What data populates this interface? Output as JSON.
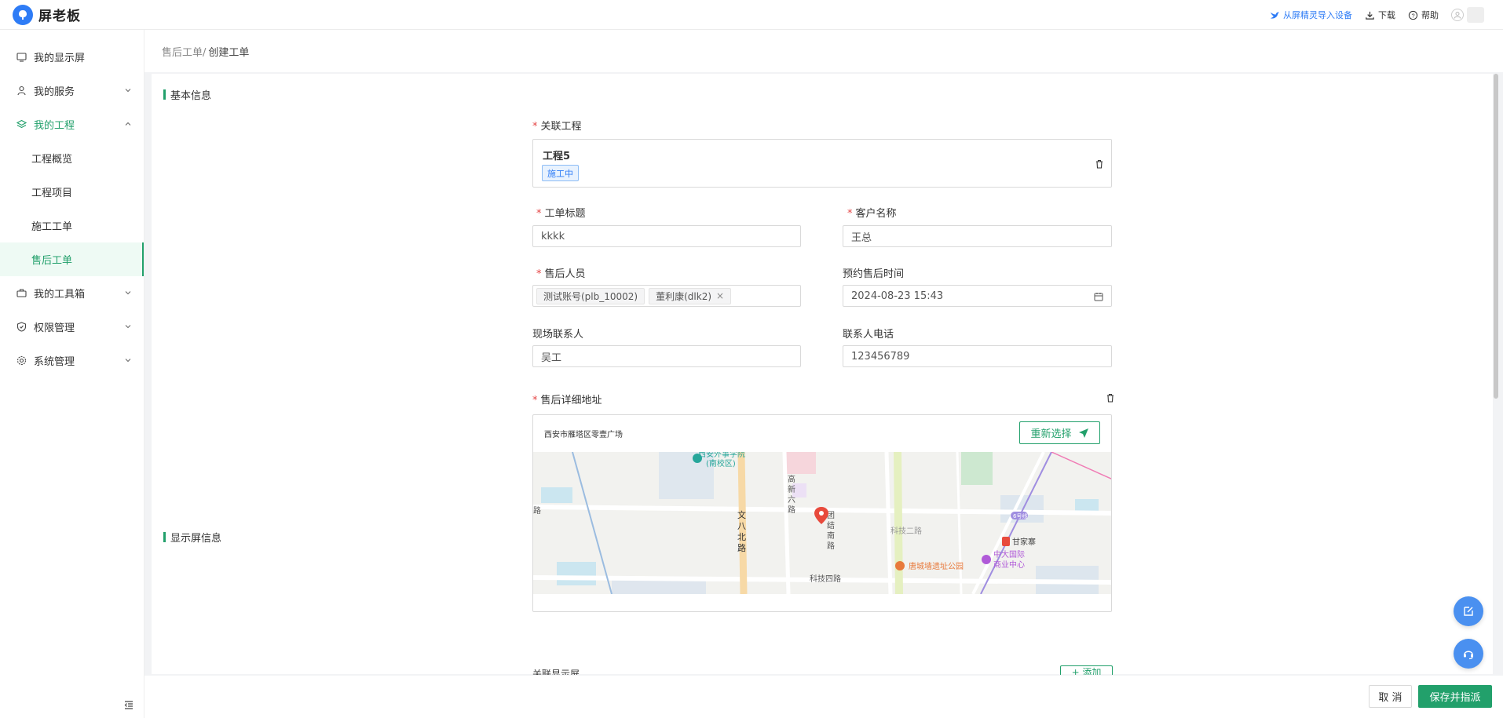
{
  "app": {
    "name": "屏老板"
  },
  "header": {
    "import_label": "从屏精灵导入设备",
    "download_label": "下载",
    "help_label": "帮助"
  },
  "sidebar": {
    "items": [
      {
        "label": "我的显示屏"
      },
      {
        "label": "我的服务"
      },
      {
        "label": "我的工程"
      },
      {
        "label": "我的工具箱"
      },
      {
        "label": "权限管理"
      },
      {
        "label": "系统管理"
      }
    ],
    "sub_items": [
      {
        "label": "工程概览"
      },
      {
        "label": "工程项目"
      },
      {
        "label": "施工工单"
      },
      {
        "label": "售后工单"
      }
    ]
  },
  "breadcrumb": {
    "parent": "售后工单/",
    "current": "创建工单"
  },
  "form": {
    "section_basic": "基本信息",
    "project_label": "关联工程",
    "project_name": "工程5",
    "project_status": "施工中",
    "title_label": "工单标题",
    "title_value": "kkkk",
    "customer_label": "客户名称",
    "customer_value": "王总",
    "staff_label": "售后人员",
    "staff_tags": [
      "测试账号(plb_10002)",
      "董利康(dlk2)"
    ],
    "time_label": "预约售后时间",
    "time_value": "2024-08-23 15:43",
    "contact_label": "现场联系人",
    "contact_value": "吴工",
    "phone_label": "联系人电话",
    "phone_value": "123456789",
    "address_label": "售后详细地址",
    "address_value": "西安市雁塔区零壹广场",
    "reselect_label": "重新选择",
    "section_screen": "显示屏信息",
    "screen_sub_label": "关联显示屏",
    "add_label": "+ 添加"
  },
  "map": {
    "labels": [
      "西安外事学院",
      "(南校区)",
      "高新六路",
      "文八北路",
      "团结南路",
      "科技二路",
      "科技四路",
      "甘家寨",
      "中大国际",
      "商业中心",
      "唐城墙遗址公园",
      "路",
      "6号线"
    ]
  },
  "footer": {
    "cancel_label": "取 消",
    "save_label": "保存并指派"
  },
  "colors": {
    "brand": "#22a06b",
    "link": "#2e7cf6",
    "required": "#e54545"
  }
}
